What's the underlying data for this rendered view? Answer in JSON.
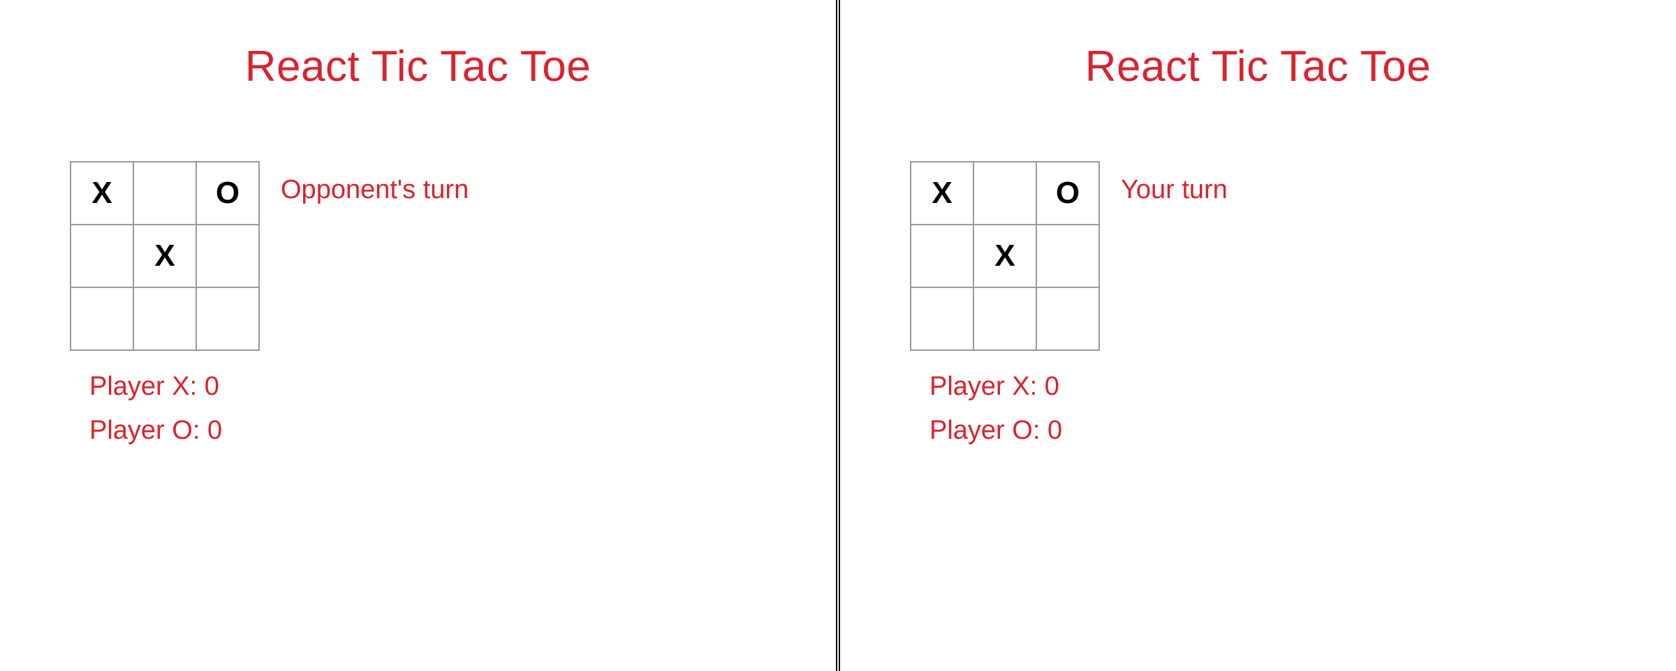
{
  "colors": {
    "brand": "#d9232e",
    "cellBorder": "#999999",
    "mark": "#000000"
  },
  "panes": [
    {
      "title": "React Tic Tac Toe",
      "status": "Opponent's turn",
      "board": [
        "X",
        "",
        "O",
        "",
        "X",
        "",
        "",
        "",
        ""
      ],
      "scores": {
        "x_label": "Player X:",
        "x_value": "0",
        "o_label": "Player O:",
        "o_value": "0"
      }
    },
    {
      "title": "React Tic Tac Toe",
      "status": "Your turn",
      "board": [
        "X",
        "",
        "O",
        "",
        "X",
        "",
        "",
        "",
        ""
      ],
      "scores": {
        "x_label": "Player X:",
        "x_value": "0",
        "o_label": "Player O:",
        "o_value": "0"
      }
    }
  ]
}
